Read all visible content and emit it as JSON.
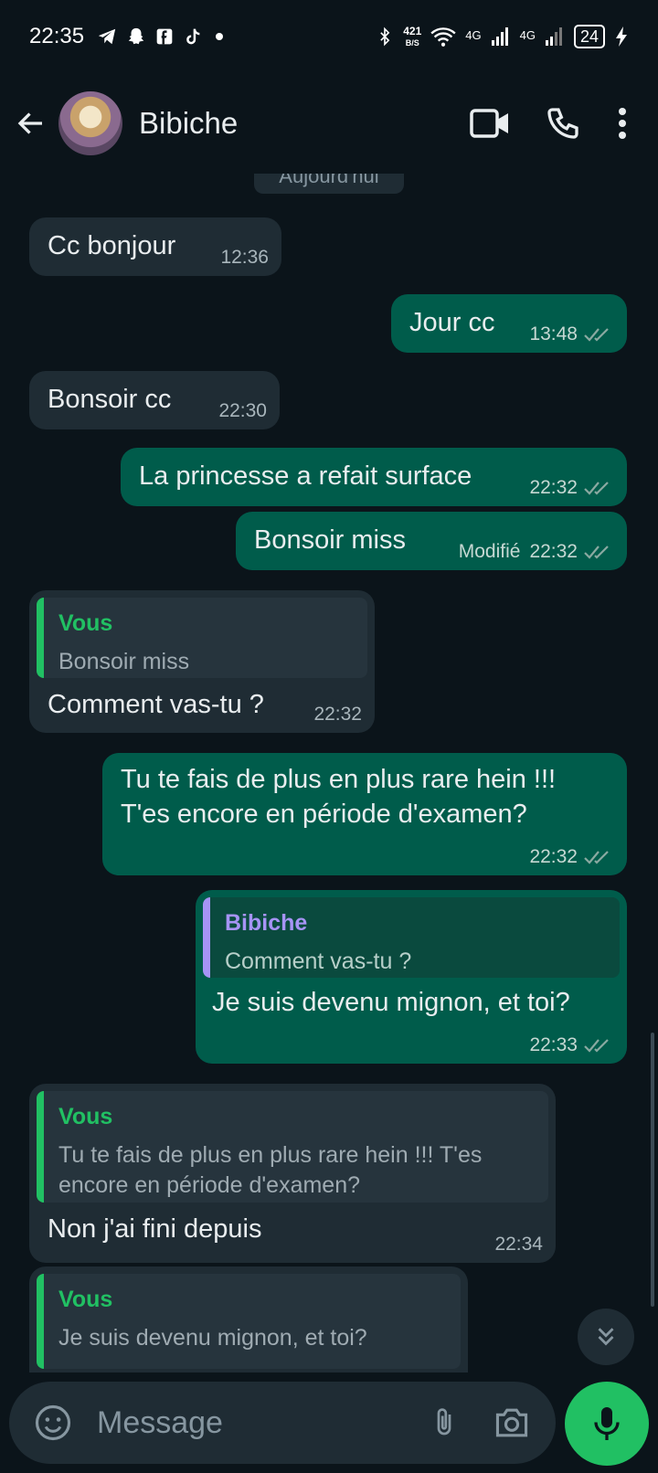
{
  "status_bar": {
    "time": "22:35",
    "net_speed_value": "421",
    "net_speed_unit": "B/S",
    "network_1": "4G",
    "network_2": "4G",
    "battery": "24"
  },
  "header": {
    "contact_name": "Bibiche"
  },
  "chat": {
    "date_chip": "Aujourd'hui",
    "messages": [
      {
        "dir": "in",
        "text": "Cc bonjour",
        "time": "12:36"
      },
      {
        "dir": "out",
        "text": "Jour cc",
        "time": "13:48"
      },
      {
        "dir": "in",
        "text": "Bonsoir cc",
        "time": "22:30"
      },
      {
        "dir": "out",
        "text": "La princesse a refait surface",
        "time": "22:32"
      },
      {
        "dir": "out",
        "text": "Bonsoir miss",
        "edited": "Modifié",
        "time": "22:32"
      },
      {
        "dir": "in",
        "quote_author": "Vous",
        "quote_text": "Bonsoir miss",
        "text": "Comment vas-tu ?",
        "time": "22:32"
      },
      {
        "dir": "out",
        "text": "Tu te fais de plus en plus rare hein !!!\nT'es encore en période d'examen?",
        "time": "22:32"
      },
      {
        "dir": "out",
        "quote_author": "Bibiche",
        "quote_text": "Comment vas-tu ?",
        "text": "Je suis devenu mignon, et toi?",
        "time": "22:33"
      },
      {
        "dir": "in",
        "quote_author": "Vous",
        "quote_text": "Tu te fais de plus en plus rare hein !!! T'es\nencore en période d'examen?",
        "text": "Non j'ai fini depuis",
        "time": "22:34"
      },
      {
        "dir": "in",
        "quote_author": "Vous",
        "quote_text": "Je suis devenu mignon, et toi?"
      }
    ]
  },
  "input": {
    "placeholder": "Message"
  },
  "colors": {
    "background": "#0b141a",
    "incoming_bubble": "#1f2c34",
    "outgoing_bubble": "#005c4b",
    "accent": "#21c063"
  }
}
